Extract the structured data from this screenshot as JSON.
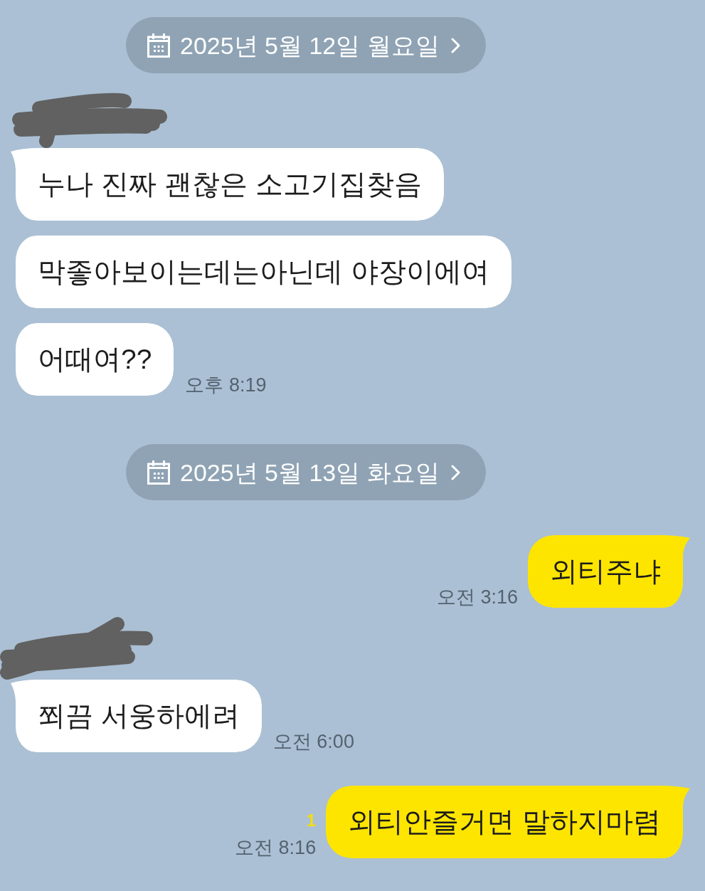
{
  "chat": [
    {
      "kind": "date",
      "label": "2025년 5월 12일 월요일"
    },
    {
      "kind": "redacted_name"
    },
    {
      "kind": "received",
      "text": "누나 진짜 괜찮은 소고기집찾음",
      "tail": true
    },
    {
      "kind": "received",
      "text": "막좋아보이는데는아닌데 야장이에여",
      "tail": false
    },
    {
      "kind": "received",
      "text": "어때여??",
      "tail": false,
      "time": "오후 8:19"
    },
    {
      "kind": "date",
      "label": "2025년 5월 13일 화요일"
    },
    {
      "kind": "sent",
      "text": "외티주냐",
      "tail": true,
      "time": "오전 3:16"
    },
    {
      "kind": "redacted_name"
    },
    {
      "kind": "received",
      "text": "쬐끔 서웅하에려",
      "tail": true,
      "time": "오전 6:00"
    },
    {
      "kind": "sent",
      "text": "외티안즐거면 말하지마렴",
      "tail": true,
      "time": "오전 8:16",
      "unread": "1"
    }
  ]
}
